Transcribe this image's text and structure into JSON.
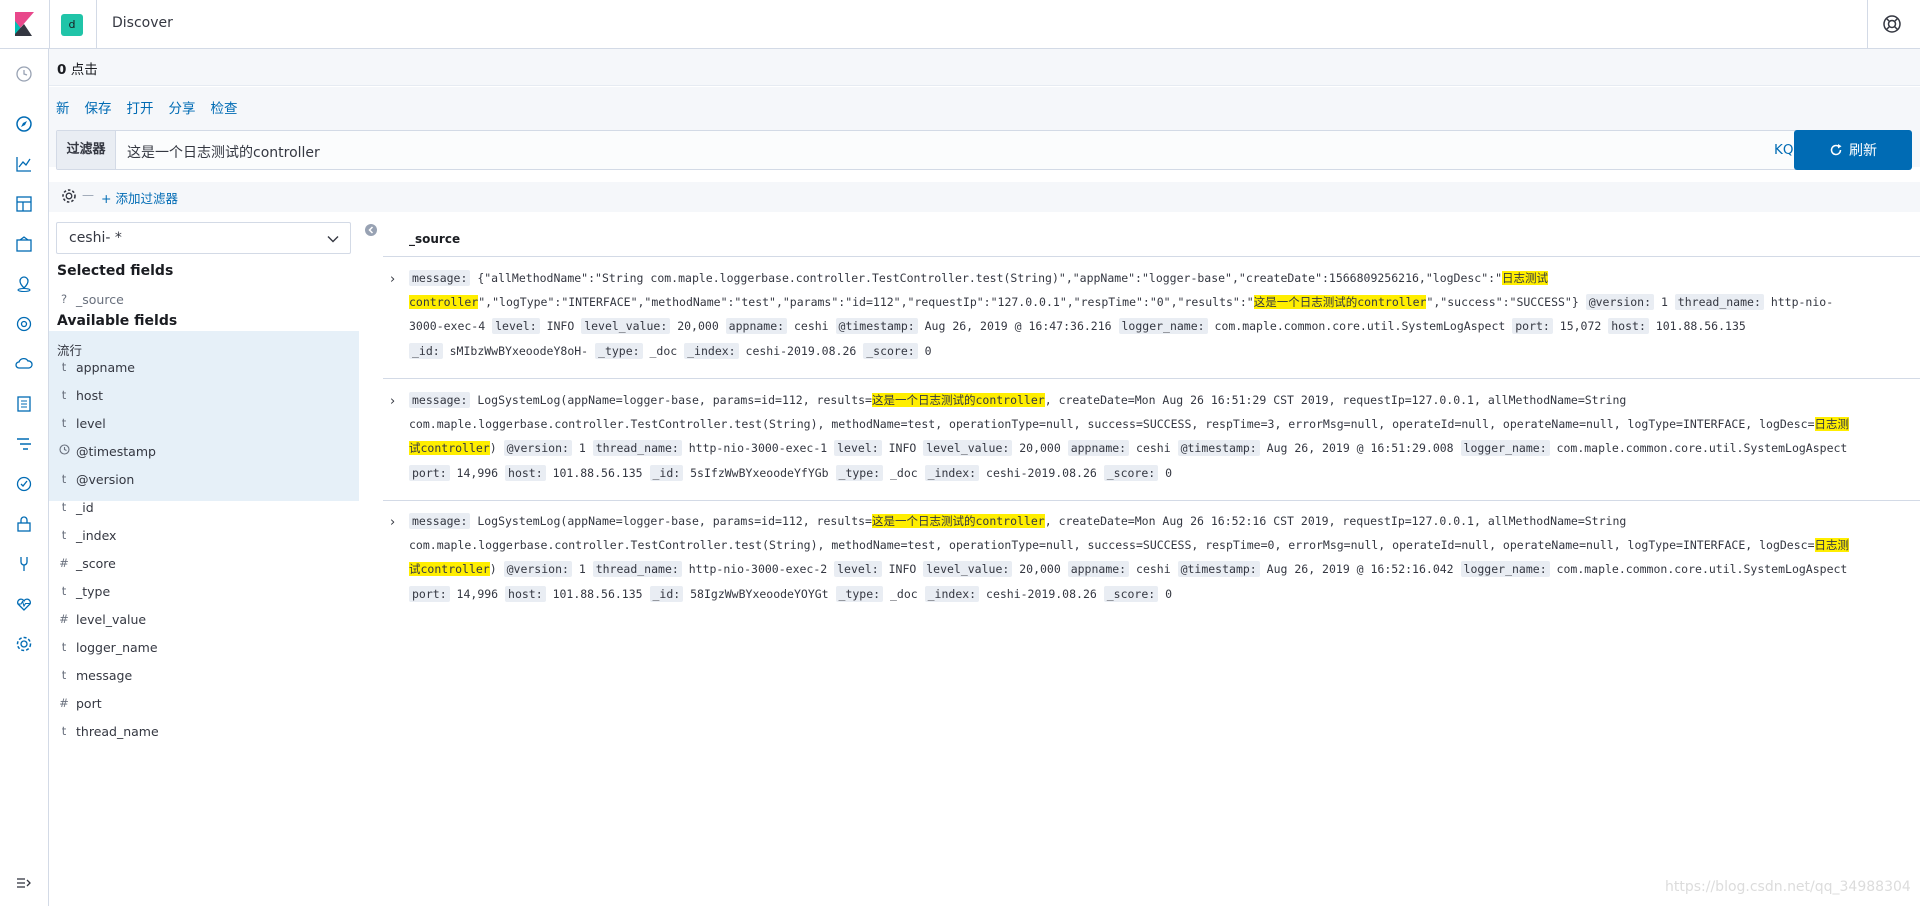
{
  "header": {
    "space_initial": "d",
    "app_title": "Discover"
  },
  "hits": {
    "count": "0",
    "label": "点击"
  },
  "menu": {
    "items": [
      "新",
      "保存",
      "打开",
      "分享",
      "检查"
    ]
  },
  "query": {
    "label": "过滤器",
    "value": "这是一个日志测试的controller",
    "language": "KQL"
  },
  "refresh_button": "刷新",
  "filter_bar": {
    "add_label": "+ 添加过滤器"
  },
  "sidebar": {
    "index_pattern": "ceshi- *",
    "selected_heading": "Selected fields",
    "selected_fields": [
      {
        "type": "?",
        "name": "_source"
      }
    ],
    "available_heading": "Available fields",
    "popular_heading": "流行",
    "fields": [
      {
        "type": "t",
        "name": "appname"
      },
      {
        "type": "t",
        "name": "host"
      },
      {
        "type": "t",
        "name": "level"
      },
      {
        "type": "clock",
        "name": "@timestamp"
      },
      {
        "type": "t",
        "name": "@version"
      },
      {
        "type": "t",
        "name": "_id"
      },
      {
        "type": "t",
        "name": "_index"
      },
      {
        "type": "#",
        "name": "_score"
      },
      {
        "type": "t",
        "name": "_type"
      },
      {
        "type": "#",
        "name": "level_value"
      },
      {
        "type": "t",
        "name": "logger_name"
      },
      {
        "type": "t",
        "name": "message"
      },
      {
        "type": "#",
        "name": "port"
      },
      {
        "type": "t",
        "name": "thread_name"
      }
    ]
  },
  "table": {
    "column_header": "_source"
  },
  "documents": [
    {
      "lines": [
        [
          [
            "k",
            "message:"
          ],
          [
            "t",
            " {\"allMethodName\":\"String com.maple.loggerbase.controller.TestController.test(String)\",\"appName\":\"logger-base\",\"createDate\":1566809256216,\"logDesc\":\""
          ],
          [
            "h",
            "日志测试"
          ]
        ],
        [
          [
            "h",
            "controller"
          ],
          [
            "t",
            "\",\"logType\":\"INTERFACE\",\"methodName\":\"test\",\"params\":\"id=112\",\"requestIp\":\"127.0.0.1\",\"respTime\":\"0\",\"results\":\""
          ],
          [
            "h",
            "这是一个日志测试的controller"
          ],
          [
            "t",
            "\",\"success\":\"SUCCESS\"} "
          ],
          [
            "k",
            "@version:"
          ],
          [
            "t",
            " 1 "
          ],
          [
            "k",
            "thread_name:"
          ],
          [
            "t",
            " http-nio-"
          ]
        ],
        [
          [
            "t",
            "3000-exec-4 "
          ],
          [
            "k",
            "level:"
          ],
          [
            "t",
            " INFO "
          ],
          [
            "k",
            "level_value:"
          ],
          [
            "t",
            " 20,000 "
          ],
          [
            "k",
            "appname:"
          ],
          [
            "t",
            " ceshi "
          ],
          [
            "k",
            "@timestamp:"
          ],
          [
            "t",
            " Aug 26, 2019 @ 16:47:36.216 "
          ],
          [
            "k",
            "logger_name:"
          ],
          [
            "t",
            " com.maple.common.core.util.SystemLogAspect "
          ],
          [
            "k",
            "port:"
          ],
          [
            "t",
            " 15,072 "
          ],
          [
            "k",
            "host:"
          ],
          [
            "t",
            " 101.88.56.135"
          ]
        ],
        [
          [
            "k",
            "_id:"
          ],
          [
            "t",
            " sMIbzWwBYxeoodeY8oH- "
          ],
          [
            "k",
            "_type:"
          ],
          [
            "t",
            " _doc "
          ],
          [
            "k",
            "_index:"
          ],
          [
            "t",
            " ceshi-2019.08.26 "
          ],
          [
            "k",
            "_score:"
          ],
          [
            "t",
            " 0"
          ]
        ]
      ]
    },
    {
      "lines": [
        [
          [
            "k",
            "message:"
          ],
          [
            "t",
            " LogSystemLog(appName=logger-base, params=id=112, results="
          ],
          [
            "h",
            "这是一个日志测试的controller"
          ],
          [
            "t",
            ", createDate=Mon Aug 26 16:51:29 CST 2019, requestIp=127.0.0.1, allMethodName=String"
          ]
        ],
        [
          [
            "t",
            "com.maple.loggerbase.controller.TestController.test(String), methodName=test, operationType=null, success=SUCCESS, respTime=3, errorMsg=null, operateId=null, operateName=null, logType=INTERFACE, logDesc="
          ],
          [
            "h",
            "日志测"
          ]
        ],
        [
          [
            "h",
            "试controller"
          ],
          [
            "t",
            ") "
          ],
          [
            "k",
            "@version:"
          ],
          [
            "t",
            " 1 "
          ],
          [
            "k",
            "thread_name:"
          ],
          [
            "t",
            " http-nio-3000-exec-1 "
          ],
          [
            "k",
            "level:"
          ],
          [
            "t",
            " INFO "
          ],
          [
            "k",
            "level_value:"
          ],
          [
            "t",
            " 20,000 "
          ],
          [
            "k",
            "appname:"
          ],
          [
            "t",
            " ceshi "
          ],
          [
            "k",
            "@timestamp:"
          ],
          [
            "t",
            " Aug 26, 2019 @ 16:51:29.008 "
          ],
          [
            "k",
            "logger_name:"
          ],
          [
            "t",
            " com.maple.common.core.util.SystemLogAspect"
          ]
        ],
        [
          [
            "k",
            "port:"
          ],
          [
            "t",
            " 14,996 "
          ],
          [
            "k",
            "host:"
          ],
          [
            "t",
            " 101.88.56.135 "
          ],
          [
            "k",
            "_id:"
          ],
          [
            "t",
            " 5sIfzWwBYxeoodeYfYGb "
          ],
          [
            "k",
            "_type:"
          ],
          [
            "t",
            " _doc "
          ],
          [
            "k",
            "_index:"
          ],
          [
            "t",
            " ceshi-2019.08.26 "
          ],
          [
            "k",
            "_score:"
          ],
          [
            "t",
            " 0"
          ]
        ]
      ]
    },
    {
      "lines": [
        [
          [
            "k",
            "message:"
          ],
          [
            "t",
            " LogSystemLog(appName=logger-base, params=id=112, results="
          ],
          [
            "h",
            "这是一个日志测试的controller"
          ],
          [
            "t",
            ", createDate=Mon Aug 26 16:52:16 CST 2019, requestIp=127.0.0.1, allMethodName=String"
          ]
        ],
        [
          [
            "t",
            "com.maple.loggerbase.controller.TestController.test(String), methodName=test, operationType=null, success=SUCCESS, respTime=0, errorMsg=null, operateId=null, operateName=null, logType=INTERFACE, logDesc="
          ],
          [
            "h",
            "日志测"
          ]
        ],
        [
          [
            "h",
            "试controller"
          ],
          [
            "t",
            ") "
          ],
          [
            "k",
            "@version:"
          ],
          [
            "t",
            " 1 "
          ],
          [
            "k",
            "thread_name:"
          ],
          [
            "t",
            " http-nio-3000-exec-2 "
          ],
          [
            "k",
            "level:"
          ],
          [
            "t",
            " INFO "
          ],
          [
            "k",
            "level_value:"
          ],
          [
            "t",
            " 20,000 "
          ],
          [
            "k",
            "appname:"
          ],
          [
            "t",
            " ceshi "
          ],
          [
            "k",
            "@timestamp:"
          ],
          [
            "t",
            " Aug 26, 2019 @ 16:52:16.042 "
          ],
          [
            "k",
            "logger_name:"
          ],
          [
            "t",
            " com.maple.common.core.util.SystemLogAspect"
          ]
        ],
        [
          [
            "k",
            "port:"
          ],
          [
            "t",
            " 14,996 "
          ],
          [
            "k",
            "host:"
          ],
          [
            "t",
            " 101.88.56.135 "
          ],
          [
            "k",
            "_id:"
          ],
          [
            "t",
            " 58IgzWwBYxeoodeYOYGt "
          ],
          [
            "k",
            "_type:"
          ],
          [
            "t",
            " _doc "
          ],
          [
            "k",
            "_index:"
          ],
          [
            "t",
            " ceshi-2019.08.26 "
          ],
          [
            "k",
            "_score:"
          ],
          [
            "t",
            " 0"
          ]
        ]
      ]
    }
  ],
  "watermark": "https://blog.csdn.net/qq_34988304"
}
